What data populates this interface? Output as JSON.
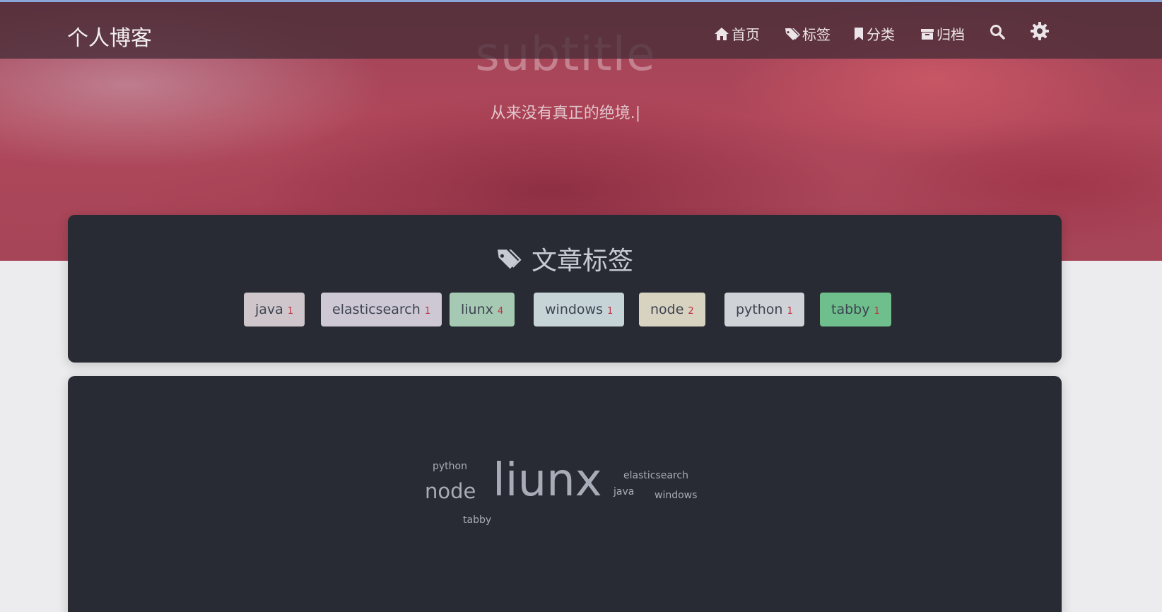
{
  "header": {
    "brand": "个人博客",
    "nav": [
      {
        "label": "首页",
        "icon": "home-icon"
      },
      {
        "label": "标签",
        "icon": "tags-icon"
      },
      {
        "label": "分类",
        "icon": "bookmark-icon"
      },
      {
        "label": "归档",
        "icon": "archive-icon"
      }
    ],
    "search_icon": "search-icon",
    "settings_icon": "gear-icon"
  },
  "hero": {
    "subtitle": "subtitle",
    "motto": "从来没有真正的绝境.|"
  },
  "tags_card": {
    "title": "文章标签",
    "title_icon": "tags-icon",
    "tags": [
      {
        "name": "java",
        "count": "1",
        "color": "#cfc6cc"
      },
      {
        "name": "elasticsearch",
        "count": "1",
        "color": "#cdc8d4"
      },
      {
        "name": "liunx",
        "count": "4",
        "color": "#a6c9b4"
      },
      {
        "name": "windows",
        "count": "1",
        "color": "#c6d4d8"
      },
      {
        "name": "node",
        "count": "2",
        "color": "#d8d2c0"
      },
      {
        "name": "python",
        "count": "1",
        "color": "#cfd2d6"
      },
      {
        "name": "tabby",
        "count": "1",
        "color": "#6fbf8d"
      }
    ]
  },
  "tag_cloud": {
    "words": [
      {
        "text": "python",
        "weight": 1
      },
      {
        "text": "node",
        "weight": 2
      },
      {
        "text": "liunx",
        "weight": 4
      },
      {
        "text": "elasticsearch",
        "weight": 1
      },
      {
        "text": "java",
        "weight": 1
      },
      {
        "text": "windows",
        "weight": 1
      },
      {
        "text": "tabby",
        "weight": 1
      }
    ]
  },
  "colors": {
    "accent_count": "#c0303e",
    "card_bg": "#282b33",
    "hero_red": "#b0475a"
  }
}
